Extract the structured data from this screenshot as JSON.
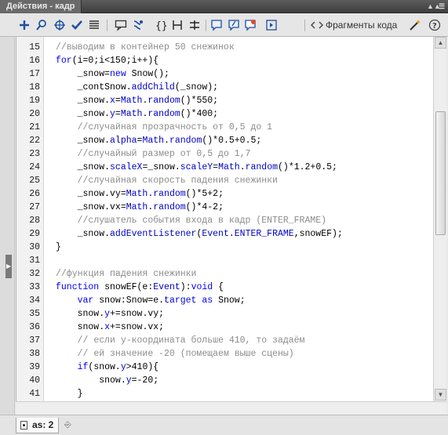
{
  "window": {
    "title": "Действия - кадр"
  },
  "toolbar": {
    "icons": [
      "add-action-icon",
      "find-icon",
      "target-path-icon",
      "check-syntax-icon",
      "auto-format-icon",
      "code-hint-icon",
      "debug-options-icon",
      "collapse-braces-icon",
      "collapse-selection-icon",
      "expand-all-icon",
      "apply-block-comment-icon",
      "apply-line-comment-icon",
      "remove-comment-icon",
      "show-hide-toolbox-icon"
    ],
    "snippets_label": "Фрагменты кода",
    "snippets_icon": "wand-icon",
    "help_icon": "help-icon"
  },
  "editor": {
    "lines": [
      {
        "n": "15",
        "t": "//выводим в контейнер 50 снежинок"
      },
      {
        "n": "16",
        "t": "for(i=0;i<150;i++){"
      },
      {
        "n": "17",
        "t": "    _snow=new Snow();"
      },
      {
        "n": "18",
        "t": "    _contSnow.addChild(_snow);"
      },
      {
        "n": "19",
        "t": "    _snow.x=Math.random()*550;"
      },
      {
        "n": "20",
        "t": "    _snow.y=Math.random()*400;"
      },
      {
        "n": "21",
        "t": "    //случайная прозрачность от 0,5 до 1"
      },
      {
        "n": "22",
        "t": "    _snow.alpha=Math.random()*0.5+0.5;"
      },
      {
        "n": "23",
        "t": "    //случайный размер от 0,5 до 1,7"
      },
      {
        "n": "24",
        "t": "    _snow.scaleX=_snow.scaleY=Math.random()*1.2+0.5;"
      },
      {
        "n": "25",
        "t": "    //случайная скорость падения снежинки"
      },
      {
        "n": "26",
        "t": "    _snow.vy=Math.random()*5+2;"
      },
      {
        "n": "27",
        "t": "    _snow.vx=Math.random()*4-2;"
      },
      {
        "n": "28",
        "t": "    //слушатель события входа в кадр (ENTER_FRAME)"
      },
      {
        "n": "29",
        "t": "    _snow.addEventListener(Event.ENTER_FRAME,snowEF);"
      },
      {
        "n": "30",
        "t": "}"
      },
      {
        "n": "31",
        "t": ""
      },
      {
        "n": "32",
        "t": "//функция падения снежинки"
      },
      {
        "n": "33",
        "t": "function snowEF(e:Event):void {"
      },
      {
        "n": "34",
        "t": "    var snow:Snow=e.target as Snow;"
      },
      {
        "n": "35",
        "t": "    snow.y+=snow.vy;"
      },
      {
        "n": "36",
        "t": "    snow.x+=snow.vx;"
      },
      {
        "n": "37",
        "t": "    // если y-координата больше 410, то задаём"
      },
      {
        "n": "38",
        "t": "    // ей значение -20 (помещаем выше сцены)"
      },
      {
        "n": "39",
        "t": "    if(snow.y>410){"
      },
      {
        "n": "40",
        "t": "        snow.y=-20;"
      },
      {
        "n": "41",
        "t": "    }"
      }
    ]
  },
  "status": {
    "tab_label": "as: 2",
    "tab_icon": "document-icon",
    "pin_icon": "pin-icon"
  },
  "colors": {
    "keyword": "#0000ff",
    "comment": "#8c8c8c",
    "property": "#0000c8",
    "title_bar": "#4a4a4a"
  }
}
